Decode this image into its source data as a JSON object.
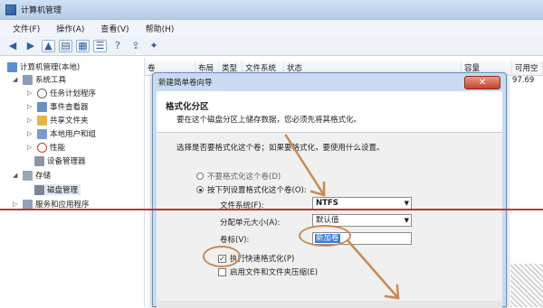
{
  "window": {
    "title": "计算机管理"
  },
  "menu": [
    "文件(F)",
    "操作(A)",
    "查看(V)",
    "帮助(H)"
  ],
  "tree": {
    "root": "计算机管理(本地)",
    "system_tools": "系统工具",
    "task_scheduler": "任务计划程序",
    "event_viewer": "事件查看器",
    "shared_folders": "共享文件夹",
    "local_users": "本地用户和组",
    "performance": "性能",
    "device_manager": "设备管理器",
    "storage": "存储",
    "disk_management": "磁盘管理",
    "services": "服务和应用程序"
  },
  "list": {
    "columns": [
      "卷",
      "布局",
      "类型",
      "文件系统",
      "状态",
      "容量",
      "可用空"
    ],
    "right_value": "97.69"
  },
  "dialog": {
    "title": "新建简单卷向导",
    "close": "✕",
    "heading": "格式化分区",
    "subheading": "要在这个磁盘分区上储存数据，您必须先将其格式化。",
    "instruction": "选择是否要格式化这个卷；如果要格式化，要使用什么设置。",
    "radio_no": "不要格式化这个卷(D)",
    "radio_yes": "按下列设置格式化这个卷(O):",
    "fs_label": "文件系统(F):",
    "fs_value": "NTFS",
    "alloc_label": "分配单元大小(A):",
    "alloc_value": "默认值",
    "vol_label": "卷标(V):",
    "vol_value": "新加卷",
    "quick_format": "执行快速格式化(P)",
    "compress": "启用文件和文件夹压缩(E)"
  },
  "colors": {
    "annotation": "#c98a53",
    "line": "#c6352a"
  }
}
